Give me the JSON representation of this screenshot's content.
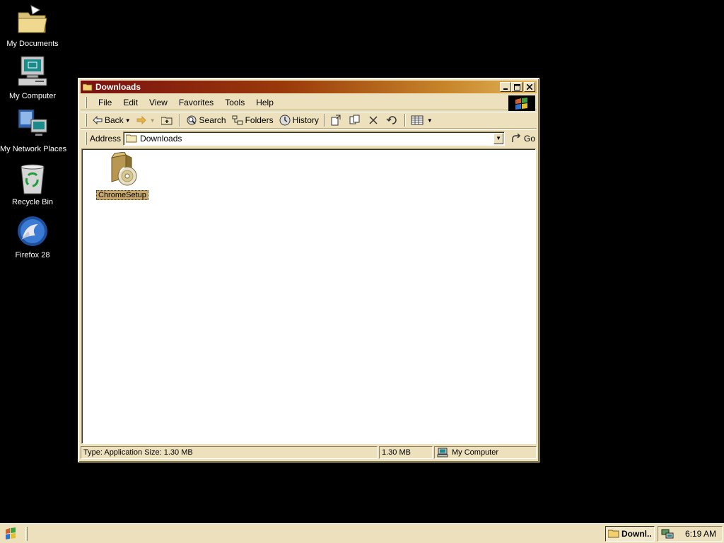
{
  "desktop": {
    "icons": [
      {
        "label": "My Documents",
        "icon": "folder-documents-icon"
      },
      {
        "label": "My Computer",
        "icon": "computer-icon"
      },
      {
        "label": "My Network Places",
        "icon": "network-places-icon"
      },
      {
        "label": "Recycle Bin",
        "icon": "recycle-bin-icon"
      },
      {
        "label": "Firefox 28",
        "icon": "firefox-icon"
      }
    ]
  },
  "window": {
    "title": "Downloads",
    "menu": [
      "File",
      "Edit",
      "View",
      "Favorites",
      "Tools",
      "Help"
    ],
    "toolbar": {
      "back": "Back",
      "search": "Search",
      "folders": "Folders",
      "history": "History"
    },
    "address": {
      "label": "Address",
      "value": "Downloads",
      "go": "Go"
    },
    "files": [
      {
        "name": "ChromeSetup",
        "icon": "installer-package-icon",
        "selected": true
      }
    ],
    "status": {
      "info": "Type: Application Size: 1.30 MB",
      "size": "1.30 MB",
      "zone": "My Computer"
    }
  },
  "taskbar": {
    "tasks": [
      {
        "label": "Downl..."
      }
    ],
    "clock": "6:19 AM"
  },
  "colors": {
    "titlebar_start": "#7a1010",
    "titlebar_end": "#e3b45a",
    "face": "#ece0bd",
    "desktop": "#000000",
    "selection": "#c9a86c"
  }
}
